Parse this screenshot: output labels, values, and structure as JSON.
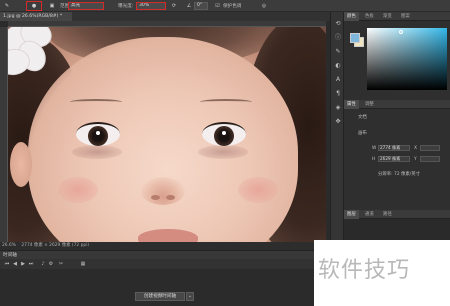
{
  "options_bar": {
    "range_label": "范围:",
    "range_value": "高光",
    "exposure_label": "曝光度:",
    "exposure_value": "30%",
    "angle_value": "0°",
    "protect_tone_label": "保护色调"
  },
  "document": {
    "tab_title": "1.jpg @ 26.6%(RGB/8#) *"
  },
  "status_bar": {
    "zoom": "26.6%",
    "doc_info": "2774 像素 × 2629 像素 (72 ppi)"
  },
  "timeline": {
    "title": "时间轴",
    "create_button": "创建视频时间轴",
    "dropdown_icon": "chevron-down-icon"
  },
  "color_panel": {
    "tabs": [
      "颜色",
      "色板",
      "渐变",
      "图案"
    ],
    "foreground_color": "#7fb7dc",
    "background_color": "#f0e3c0"
  },
  "properties_panel": {
    "tabs": [
      "属性",
      "调整"
    ],
    "doc_label": "文档",
    "canvas_label": "画布",
    "w_label": "W",
    "w_value": "2774 像素",
    "h_label": "H",
    "h_value": "2629 像素",
    "x_label": "X",
    "y_label": "Y",
    "resolution": "分辨率: 72 像素/英寸"
  },
  "layers_panel": {
    "tabs": [
      "图层",
      "通道",
      "路径"
    ]
  },
  "watermark": {
    "text": "软件技巧"
  },
  "colors": {
    "highlight_box": "#d42a2a",
    "panel_bg": "#2f2f2f"
  }
}
